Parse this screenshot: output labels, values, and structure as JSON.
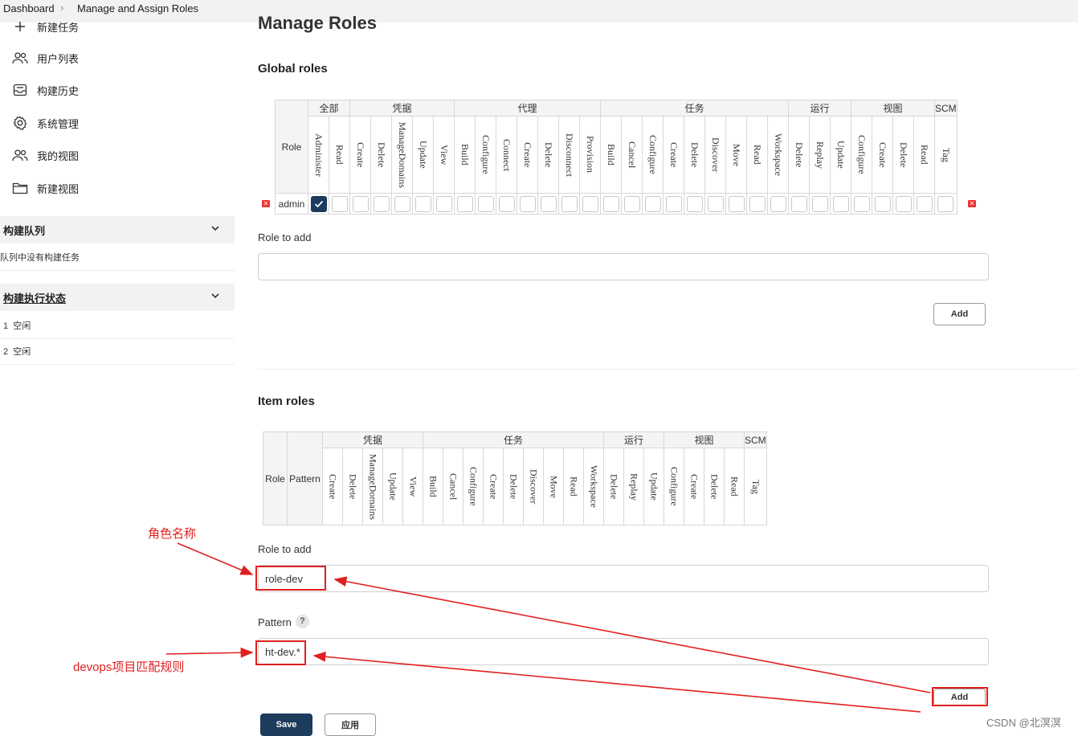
{
  "breadcrumb": {
    "home": "Dashboard",
    "current": "Manage and Assign Roles"
  },
  "sidebar": {
    "tasks": [
      {
        "label": "新建任务",
        "icon": "plus-icon"
      },
      {
        "label": "用户列表",
        "icon": "users-icon"
      },
      {
        "label": "构建历史",
        "icon": "history-icon"
      },
      {
        "label": "系统管理",
        "icon": "gear-icon"
      },
      {
        "label": "我的视图",
        "icon": "users-icon"
      },
      {
        "label": "新建视图",
        "icon": "folder-icon"
      }
    ],
    "build_queue": {
      "title": "构建队列",
      "empty_text": "队列中没有构建任务"
    },
    "executors": {
      "title": "构建执行状态",
      "items": [
        {
          "num": "1",
          "status": "空闲"
        },
        {
          "num": "2",
          "status": "空闲"
        }
      ]
    }
  },
  "page_title": "Manage Roles",
  "global_roles": {
    "title": "Global roles",
    "role_header": "Role",
    "groups": [
      {
        "name": "全部",
        "perms": [
          "Administer",
          "Read"
        ]
      },
      {
        "name": "凭据",
        "perms": [
          "Create",
          "Delete",
          "ManageDomains",
          "Update",
          "View"
        ]
      },
      {
        "name": "代理",
        "perms": [
          "Build",
          "Configure",
          "Connect",
          "Create",
          "Delete",
          "Disconnect",
          "Provision"
        ]
      },
      {
        "name": "任务",
        "perms": [
          "Build",
          "Cancel",
          "Configure",
          "Create",
          "Delete",
          "Discover",
          "Move",
          "Read",
          "Workspace"
        ]
      },
      {
        "name": "运行",
        "perms": [
          "Delete",
          "Replay",
          "Update"
        ]
      },
      {
        "name": "视图",
        "perms": [
          "Configure",
          "Create",
          "Delete",
          "Read"
        ]
      },
      {
        "name": "SCM",
        "perms": [
          "Tag"
        ]
      }
    ],
    "rows": [
      {
        "role": "admin",
        "checked_index": 0
      }
    ],
    "role_to_add_label": "Role to add",
    "role_to_add_value": "",
    "add_label": "Add"
  },
  "item_roles": {
    "title": "Item roles",
    "role_header": "Role",
    "pattern_header": "Pattern",
    "groups": [
      {
        "name": "凭据",
        "perms": [
          "Create",
          "Delete",
          "ManageDomains",
          "Update",
          "View"
        ]
      },
      {
        "name": "任务",
        "perms": [
          "Build",
          "Cancel",
          "Configure",
          "Create",
          "Delete",
          "Discover",
          "Move",
          "Read",
          "Workspace"
        ]
      },
      {
        "name": "运行",
        "perms": [
          "Delete",
          "Replay",
          "Update"
        ]
      },
      {
        "name": "视图",
        "perms": [
          "Configure",
          "Create",
          "Delete",
          "Read"
        ]
      },
      {
        "name": "SCM",
        "perms": [
          "Tag"
        ]
      }
    ],
    "role_to_add_label": "Role to add",
    "role_to_add_value": "role-dev",
    "pattern_label": "Pattern",
    "pattern_help": "?",
    "pattern_value": "ht-dev.*",
    "add_label": "Add"
  },
  "footer": {
    "save_label": "Save",
    "apply_label": "应用"
  },
  "annotations": {
    "role_name": "角色名称",
    "pattern_rule": "devops项目匹配规则"
  },
  "watermark": "CSDN @北溟溟",
  "colors": {
    "accent": "#1d3b5c",
    "annotation": "#e02020",
    "delete": "#e33333"
  }
}
